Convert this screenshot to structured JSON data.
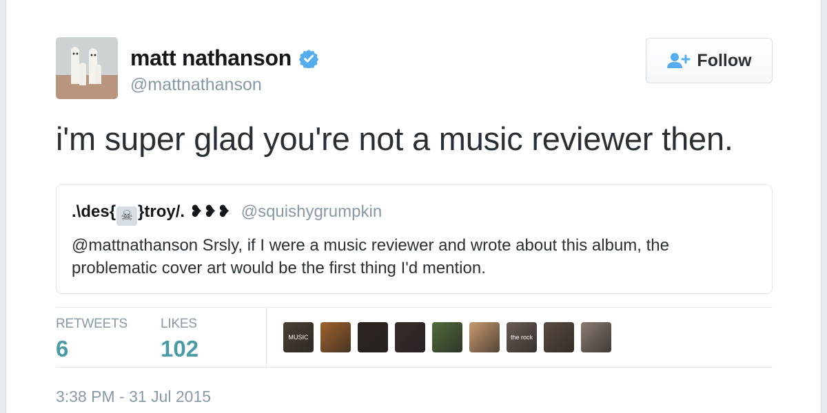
{
  "user": {
    "name": "matt nathanson",
    "handle": "@mattnathanson"
  },
  "follow_button": {
    "label": "Follow"
  },
  "tweet": {
    "text": "i'm super glad you're not a music reviewer then.",
    "timestamp": "3:38 PM - 31 Jul 2015"
  },
  "quote": {
    "name_prefix": ".\\des{",
    "name_suffix": "}troy/. ❥❥❥",
    "handle": "@squishygrumpkin",
    "text": "@mattnathanson Srsly, if I were a music reviewer and wrote about this album, the problematic cover art would be the first thing I'd mention."
  },
  "stats": {
    "retweets_label": "RETWEETS",
    "retweets_value": "6",
    "likes_label": "LIKES",
    "likes_value": "102"
  },
  "likers": [
    {
      "color": "#4a3f32",
      "label": "MUSIC"
    },
    {
      "color": "#a0622b",
      "label": ""
    },
    {
      "color": "#2d2420",
      "label": ""
    },
    {
      "color": "#3a2a2a",
      "label": ""
    },
    {
      "color": "#4f6b3a",
      "label": ""
    },
    {
      "color": "#c99a6d",
      "label": ""
    },
    {
      "color": "#6a5a52",
      "label": "the rock"
    },
    {
      "color": "#5b4a3e",
      "label": ""
    },
    {
      "color": "#8a7a70",
      "label": ""
    }
  ],
  "colors": {
    "verified": "#55acee",
    "stat_value": "#4a9ba6",
    "muted": "#8899a6"
  }
}
